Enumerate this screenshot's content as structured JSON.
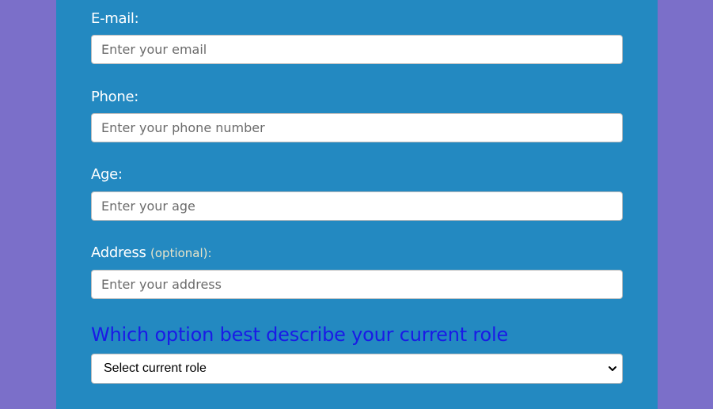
{
  "form": {
    "email": {
      "label": "E-mail:",
      "placeholder": "Enter your email",
      "value": ""
    },
    "phone": {
      "label": "Phone:",
      "placeholder": "Enter your phone number",
      "value": ""
    },
    "age": {
      "label": "Age:",
      "placeholder": "Enter your age",
      "value": ""
    },
    "address": {
      "label": "Address",
      "optional": "(optional)",
      "colon": ":",
      "placeholder": "Enter your address",
      "value": ""
    },
    "role": {
      "question": "Which option best describe your current role",
      "selected": "Select current role"
    }
  },
  "colors": {
    "background": "#7b6fc9",
    "panel": "#2389c1",
    "question": "#1a1ae6",
    "label": "#ffffff"
  },
  "icons": {
    "select_arrow": "chevron-down-icon"
  }
}
